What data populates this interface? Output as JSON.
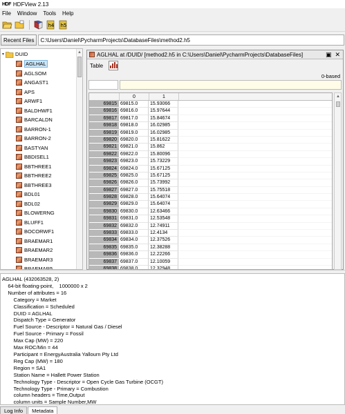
{
  "window": {
    "logo": "HDF",
    "title": "HDFView 2.13"
  },
  "menu": {
    "items": [
      "File",
      "Window",
      "Tools",
      "Help"
    ]
  },
  "pathbar": {
    "recent_label": "Recent Files",
    "path": "C:\\Users\\Daniel\\PycharmProjects\\DatabaseFiles\\method2.h5"
  },
  "tree": {
    "root": "DUID",
    "items": [
      "AGLHAL",
      "AGLSOM",
      "ANGAST1",
      "APS",
      "ARWF1",
      "BALDHWF1",
      "BARCALDN",
      "BARRON-1",
      "BARRON-2",
      "BASTYAN",
      "BBDISEL1",
      "BBTHREE1",
      "BBTHREE2",
      "BBTHREE3",
      "BDL01",
      "BDL02",
      "BLOWERNG",
      "BLUFF1",
      "BOCORWF1",
      "BRAEMAR1",
      "BRAEMAR2",
      "BRAEMAR3",
      "BRAEMAR5"
    ],
    "selected": "AGLHAL"
  },
  "dataview": {
    "title": "AGLHAL  at  /DUID/  [method2.h5  in  C:\\Users\\Daniel\\PycharmProjects\\DatabaseFiles]",
    "table_menu": "Table",
    "index_base": "0-based",
    "columns": [
      "0",
      "1"
    ],
    "rows": [
      [
        "69815",
        "69815.0",
        "15.93066"
      ],
      [
        "69816",
        "69816.0",
        "15.97644"
      ],
      [
        "69817",
        "69817.0",
        "15.84674"
      ],
      [
        "69818",
        "69818.0",
        "16.02985"
      ],
      [
        "69819",
        "69819.0",
        "16.02985"
      ],
      [
        "69820",
        "69820.0",
        "15.81622"
      ],
      [
        "69821",
        "69821.0",
        "15.862"
      ],
      [
        "69822",
        "69822.0",
        "15.80096"
      ],
      [
        "69823",
        "69823.0",
        "15.73229"
      ],
      [
        "69824",
        "69824.0",
        "15.67125"
      ],
      [
        "69825",
        "69825.0",
        "15.67125"
      ],
      [
        "69826",
        "69826.0",
        "15.73992"
      ],
      [
        "69827",
        "69827.0",
        "15.75518"
      ],
      [
        "69828",
        "69828.0",
        "15.64074"
      ],
      [
        "69829",
        "69829.0",
        "15.64074"
      ],
      [
        "69830",
        "69830.0",
        "12.63466"
      ],
      [
        "69831",
        "69831.0",
        "12.53548"
      ],
      [
        "69832",
        "69832.0",
        "12.74911"
      ],
      [
        "69833",
        "69833.0",
        "12.4134"
      ],
      [
        "69834",
        "69834.0",
        "12.37526"
      ],
      [
        "69835",
        "69835.0",
        "12.38288"
      ],
      [
        "69836",
        "69836.0",
        "12.22266"
      ],
      [
        "69837",
        "69837.0",
        "12.10059"
      ],
      [
        "69838",
        "69838.0",
        "12.32948"
      ],
      [
        "69839",
        "69839.0",
        "12.02429"
      ],
      [
        "69840",
        "69840.0",
        "12.31422"
      ]
    ]
  },
  "metadata": {
    "lines": [
      "AGLHAL (432063528, 2)",
      "    64-bit floating-point,    1000000 x 2",
      "    Number of attributes = 16",
      "        Category = Market",
      "        Classification = Scheduled",
      "        DUID = AGLHAL",
      "        Dispatch Type = Generator",
      "        Fuel Source - Descriptor = Natural Gas / Diesel",
      "        Fuel Source - Primary = Fossil",
      "        Max Cap (MW) = 220",
      "        Max ROC/Min = 44",
      "        Participant = EnergyAustralia Yallourn Pty Ltd",
      "        Reg Cap (MW) = 180",
      "        Region = SA1",
      "        Station Name = Hallett Power Station",
      "        Technology Type - Descriptor = Open Cycle Gas Turbine (OCGT)",
      "        Technology Type - Primary = Combustion",
      "        column headers = Time,Output",
      "        column units = Sample Number,MW"
    ]
  },
  "tabs": {
    "log": "Log Info",
    "metadata": "Metadata"
  }
}
